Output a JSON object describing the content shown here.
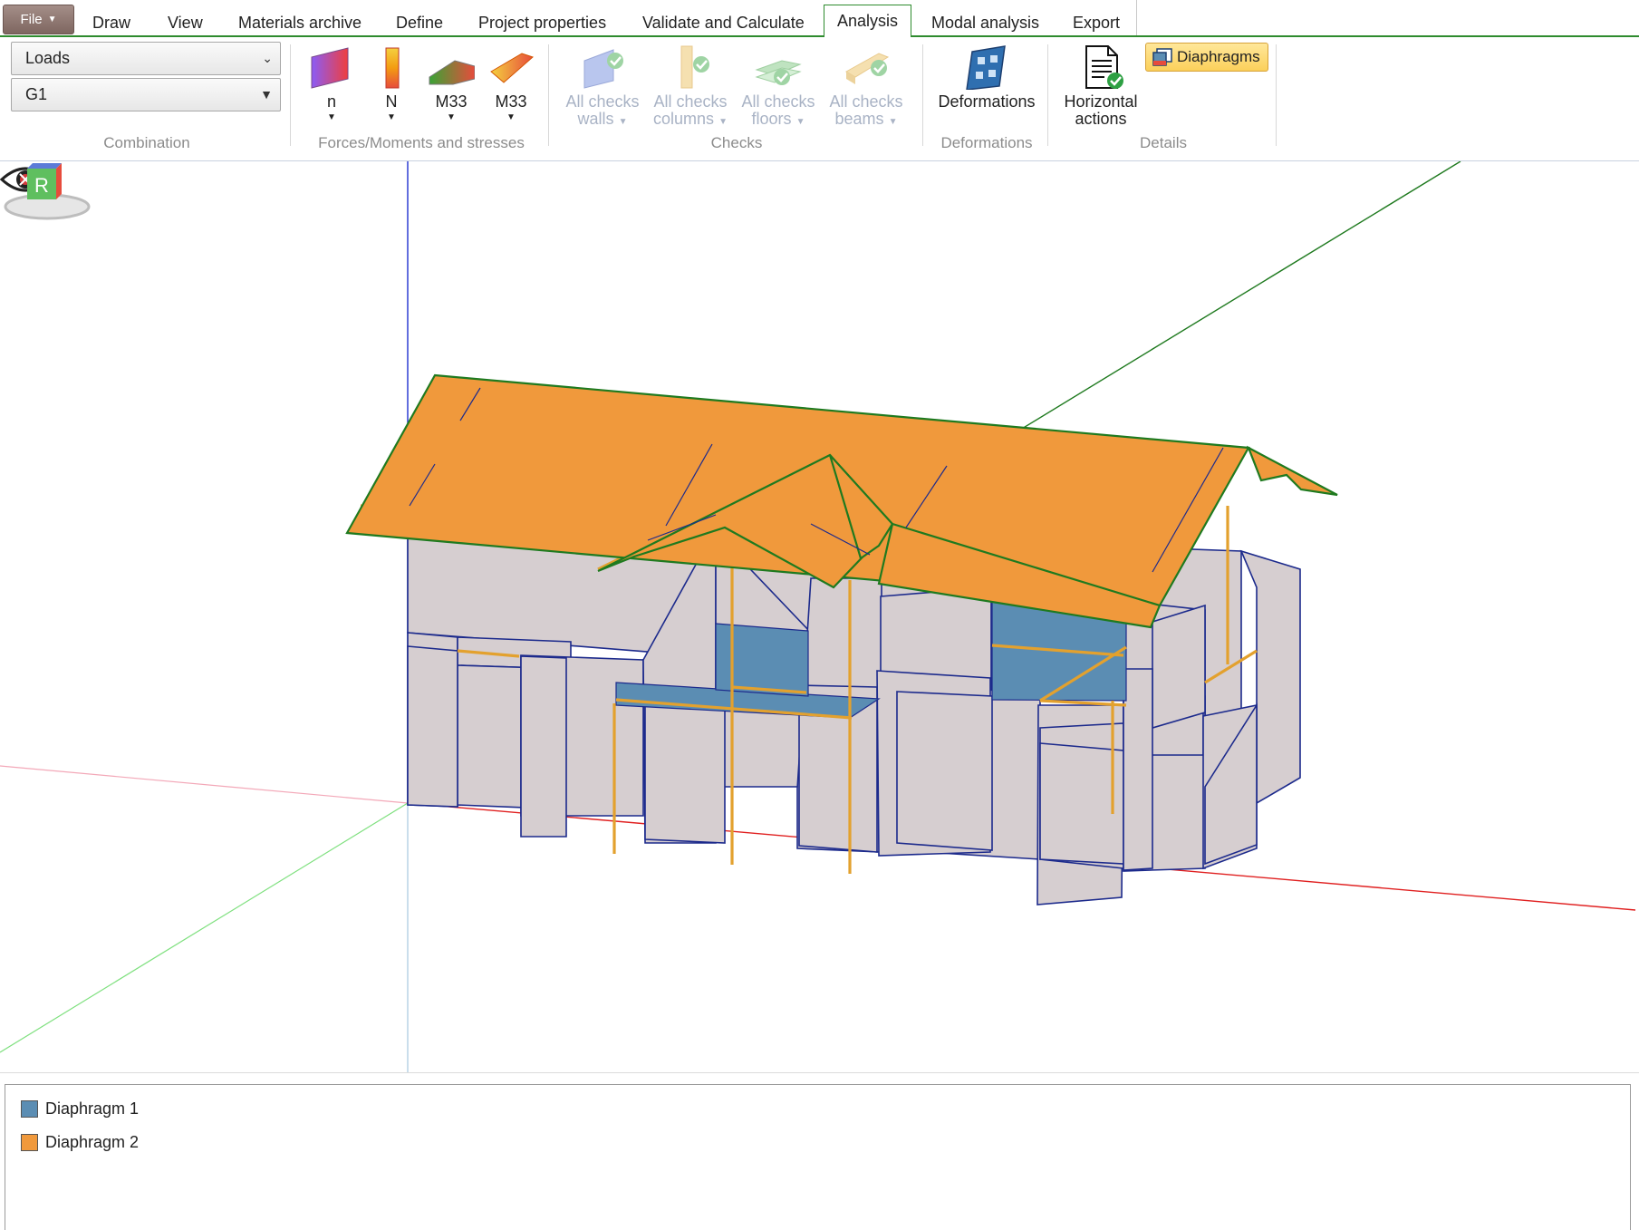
{
  "menu": {
    "file_label": "File",
    "tabs": [
      "Draw",
      "View",
      "Materials archive",
      "Define",
      "Project properties",
      "Validate and Calculate",
      "Analysis",
      "Modal analysis",
      "Export"
    ],
    "active_tab": "Analysis"
  },
  "ribbon": {
    "combination": {
      "type_value": "Loads",
      "case_value": "G1",
      "label": "Combination"
    },
    "forces": {
      "label": "Forces/Moments and stresses",
      "buttons": [
        "n",
        "N",
        "M33",
        "M33"
      ]
    },
    "checks": {
      "label": "Checks",
      "buttons": [
        {
          "line1": "All checks",
          "line2": "walls"
        },
        {
          "line1": "All checks",
          "line2": "columns"
        },
        {
          "line1": "All checks",
          "line2": "floors"
        },
        {
          "line1": "All checks",
          "line2": "beams"
        }
      ]
    },
    "deformations": {
      "label": "Deformations",
      "button": "Deformations"
    },
    "details": {
      "label": "Details",
      "horizontal_line1": "Horizontal",
      "horizontal_line2": "actions",
      "diaphragms_button": "Diaphragms"
    }
  },
  "viewport": {
    "nav_cube_letter": "R",
    "colors": {
      "diaphragm1": "#5b8db3",
      "diaphragm2": "#f0993c",
      "wall": "#d6ced0",
      "wall_edge": "#1c2a8c",
      "beam": "#e3a12e",
      "x_axis": "#e02020",
      "y_axis": "#1f7a1f",
      "z_axis": "#2030d0"
    }
  },
  "legend": {
    "items": [
      {
        "label": "Diaphragm 1",
        "color": "#5b8db3"
      },
      {
        "label": "Diaphragm 2",
        "color": "#f0993c"
      }
    ]
  }
}
